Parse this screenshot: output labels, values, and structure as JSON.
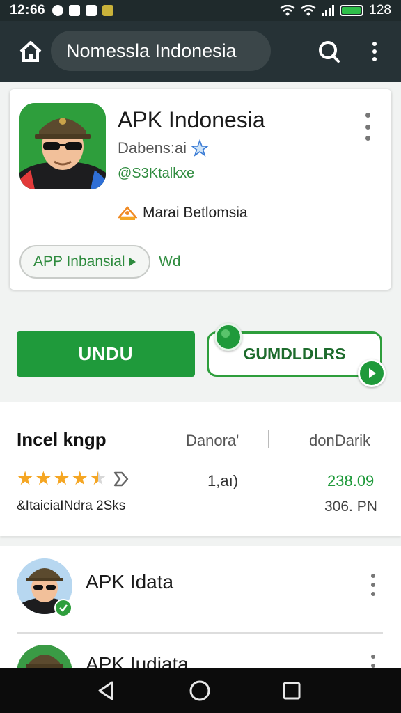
{
  "status_bar": {
    "time": "12:66",
    "right_text": "128",
    "battery_level": 0.95,
    "accent_color": "#2fbf4a"
  },
  "app_bar": {
    "search_text": "Nomessla Indonesia",
    "icons": [
      "home-icon",
      "search-icon",
      "more-vert-icon"
    ],
    "background": "#263236"
  },
  "app_header": {
    "title": "APK Indonesia",
    "developer": "Dabens:ai",
    "tagline": "@S3Ktalkхе",
    "badge_label": "Marai Betlomsia",
    "category_chip": "APP Inbansial",
    "chip_side_text": "Wd"
  },
  "actions": {
    "install_label": "UNDU",
    "secondary_label": "GUMDLDLRS",
    "brand_color": "#1f9a3b"
  },
  "stats": {
    "heading": "Incel kngp",
    "col2_heading": "Danora'",
    "col3_heading": "donDarik",
    "rating_stars": 4.5,
    "col2_value": "1,aı)",
    "col3_value": "238.09",
    "subtitle": "&ItaiciaINdra 2Sks",
    "col3_sub": "306. PN"
  },
  "list": {
    "items": [
      {
        "title": "APK Idata"
      },
      {
        "title": "APK Iudiata"
      }
    ]
  },
  "nav_bar": {
    "icons": [
      "back-icon",
      "home-circle-icon",
      "recents-icon"
    ]
  }
}
